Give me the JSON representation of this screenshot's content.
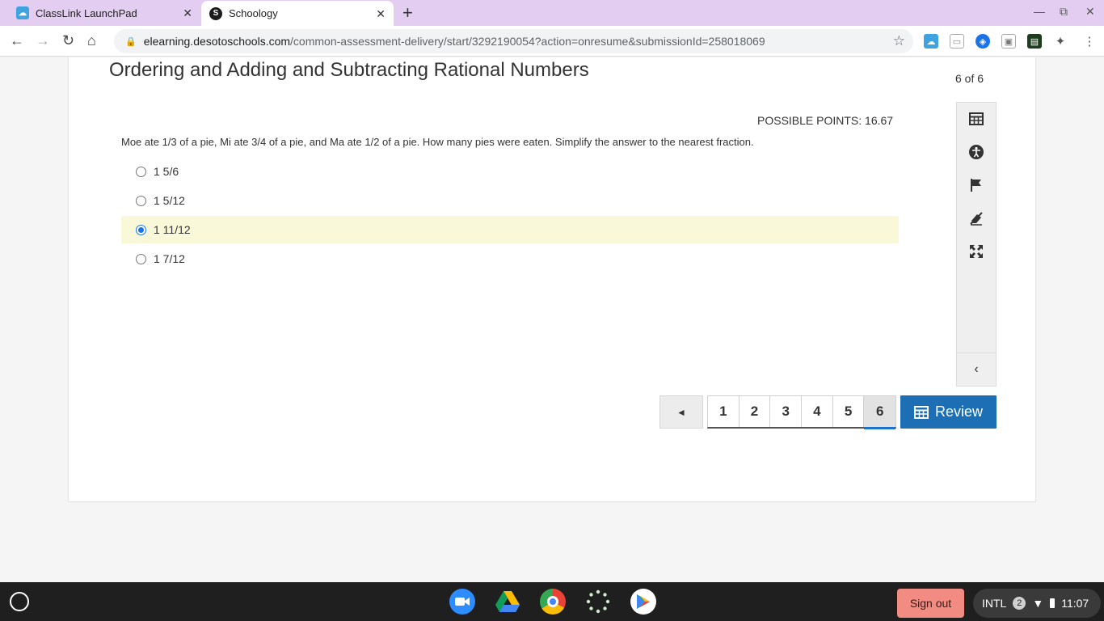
{
  "browser": {
    "tabs": [
      {
        "title": "ClassLink LaunchPad",
        "active": false
      },
      {
        "title": "Schoology",
        "active": true
      }
    ],
    "url_host": "elearning.desotoschools.com",
    "url_path": "/common-assessment-delivery/start/3292190054?action=onresume&submissionId=258018069"
  },
  "assessment": {
    "title": "Ordering and Adding and Subtracting Rational Numbers",
    "counter": "6 of 6",
    "possible_points": "POSSIBLE POINTS: 16.67",
    "question": "Moe ate 1/3 of a pie, Mi ate 3/4 of a pie, and Ma ate 1/2 of a pie.  How many pies were eaten.  Simplify the answer to the nearest fraction.",
    "choices": [
      {
        "label": "1 5/6",
        "selected": false
      },
      {
        "label": "1 5/12",
        "selected": false
      },
      {
        "label": "1 11/12",
        "selected": true
      },
      {
        "label": "1 7/12",
        "selected": false
      }
    ],
    "pages": [
      "1",
      "2",
      "3",
      "4",
      "5",
      "6"
    ],
    "current_page": "6",
    "prev_symbol": "◄",
    "review_label": "Review"
  },
  "shelf": {
    "signout_label": "Sign out",
    "keyboard": "INTL",
    "notification_count": "2",
    "time": "11:07"
  },
  "colors": {
    "tabstrip": "#e3cdf1",
    "selected_choice_bg": "#f9f9d9",
    "review_button": "#1c6fb5",
    "signout_button": "#f28b82"
  }
}
